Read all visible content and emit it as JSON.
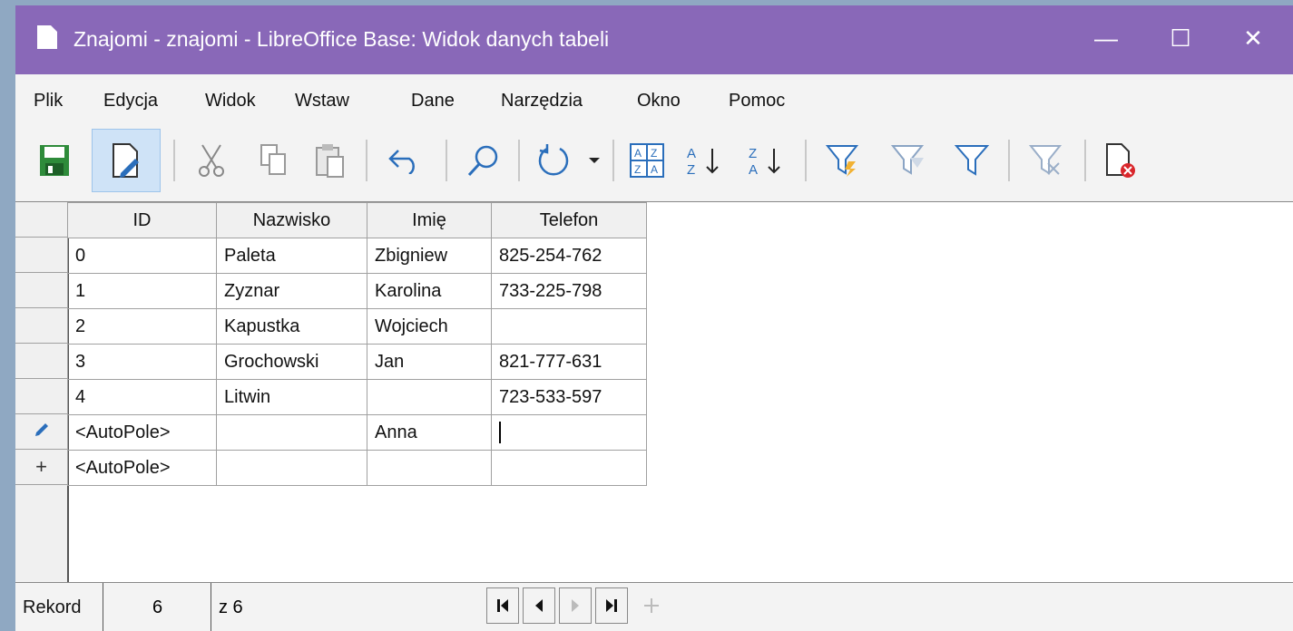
{
  "window": {
    "title": "Znajomi - znajomi - LibreOffice Base: Widok danych tabeli",
    "controls": {
      "minimize": "—",
      "maximize": "☐",
      "close": "✕"
    }
  },
  "menu": [
    "Plik",
    "Edycja",
    "Widok",
    "Wstaw",
    "Dane",
    "Narzędzia",
    "Okno",
    "Pomoc"
  ],
  "toolbar": {
    "icons": [
      "save-icon",
      "edit-data-icon",
      "cut-icon",
      "copy-icon",
      "paste-icon",
      "undo-icon",
      "find-icon",
      "refresh-icon",
      "refresh-dropdown-icon",
      "sort-icon",
      "sort-ascending-icon",
      "sort-descending-icon",
      "autofilter-icon",
      "standard-filter-icon",
      "apply-filter-icon",
      "remove-filter-icon",
      "delete-record-icon"
    ]
  },
  "table": {
    "columns": [
      "ID",
      "Nazwisko",
      "Imię",
      "Telefon"
    ],
    "rows": [
      {
        "id": "0",
        "nazwisko": "Paleta",
        "imie": "Zbigniew",
        "telefon": "825-254-762",
        "marker": ""
      },
      {
        "id": "1",
        "nazwisko": "Zyznar",
        "imie": "Karolina",
        "telefon": "733-225-798",
        "marker": ""
      },
      {
        "id": "2",
        "nazwisko": "Kapustka",
        "imie": "Wojciech",
        "telefon": "",
        "marker": ""
      },
      {
        "id": "3",
        "nazwisko": "Grochowski",
        "imie": "Jan",
        "telefon": "821-777-631",
        "marker": ""
      },
      {
        "id": "4",
        "nazwisko": "Litwin",
        "imie": "",
        "telefon": "723-533-597",
        "marker": ""
      },
      {
        "id": "<AutoPole>",
        "nazwisko": "",
        "imie": "Anna",
        "telefon": "",
        "marker": "pencil-icon"
      },
      {
        "id": "<AutoPole>",
        "nazwisko": "",
        "imie": "",
        "telefon": "",
        "marker": "+"
      }
    ]
  },
  "status": {
    "record_label": "Rekord",
    "record_number": "6",
    "record_total": "z 6"
  },
  "colors": {
    "titlebar": "#8968b8",
    "accent": "#2a6ebb"
  }
}
